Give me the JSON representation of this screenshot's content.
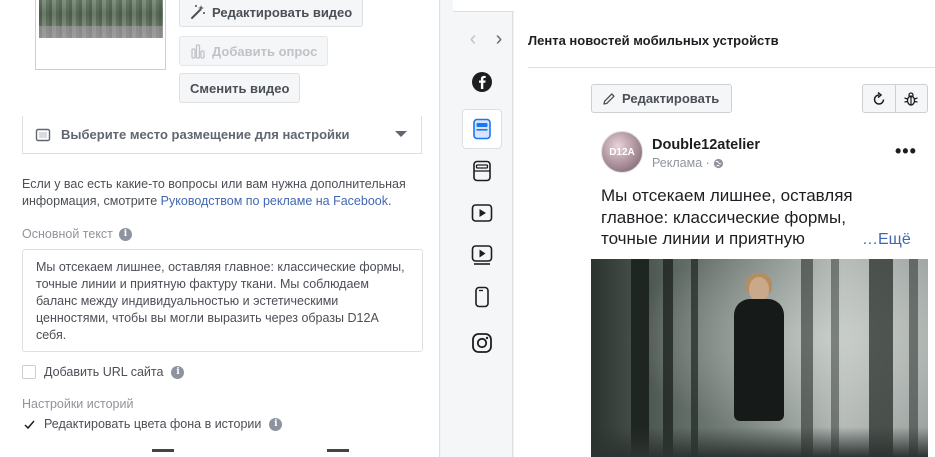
{
  "left_panel": {
    "edit_video_label": "Редактировать видео",
    "add_poll_label": "Добавить опрос",
    "change_video_label": "Сменить видео",
    "placement_label": "Выберите место размещение для настройки",
    "help_text_before": "Если у вас есть какие-то вопросы или вам нужна дополнительная информация, смотрите ",
    "help_link": "Руководством по рекламе на Facebook",
    "help_text_after": ".",
    "primary_text_label": "Основной текст",
    "primary_text_value": "Мы отсекаем лишнее, оставляя главное: классические формы, точные линии и приятную фактуру ткани. Мы соблюдаем баланс между индивидуальностью и эстетическими ценностями, чтобы вы могли выразить через образы D12A себя.",
    "add_url_label": "Добавить URL сайта",
    "stories_settings_title": "Настройки историй",
    "edit_bg_colors_label": "Редактировать цвета фона в истории"
  },
  "rail": {
    "icons": [
      "facebook-icon",
      "feed-icon",
      "right-column-icon",
      "instant-video-icon",
      "in-stream-video-icon",
      "stories-icon",
      "instagram-icon"
    ]
  },
  "preview": {
    "title": "Лента новостей мобильных устройств",
    "edit_label": "Редактировать",
    "page_name": "Double12atelier",
    "sponsored": "Реклама ·",
    "avatar_text": "D12A",
    "post_text": "Мы отсекаем лишнее, оставляя главное: классические формы, точные линии и приятную",
    "see_more": "…Ещё",
    "more": "•••"
  },
  "colors": {
    "link": "#4267b2",
    "border": "#dddfe2",
    "text_secondary": "#90949c"
  }
}
